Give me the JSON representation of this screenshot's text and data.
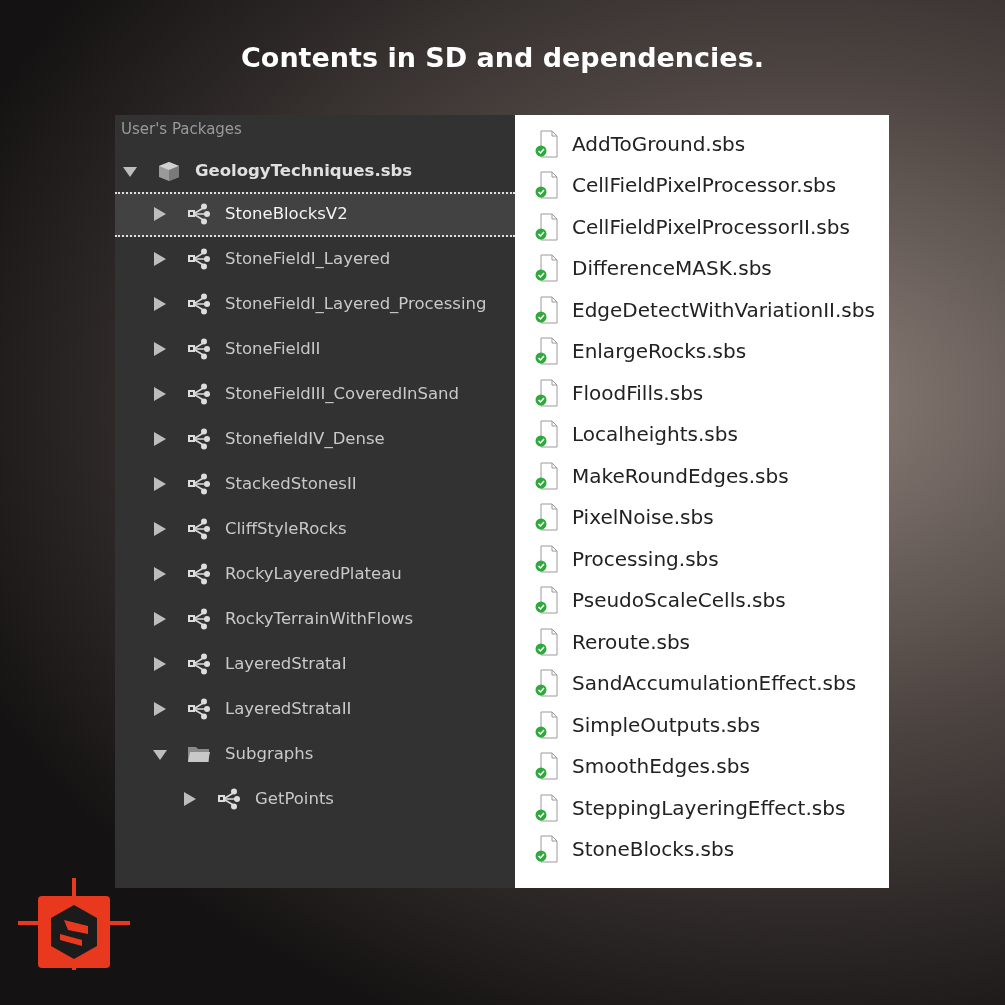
{
  "headline": "Contents in SD and dependencies.",
  "explorer": {
    "header": "User's Packages",
    "tree": [
      {
        "label": "GeologyTechniques.sbs",
        "kind": "package",
        "expanded": true,
        "selected": false,
        "children": [
          {
            "label": "StoneBlocksV2",
            "kind": "graph",
            "expanded": false,
            "selected": true
          },
          {
            "label": "StoneFieldI_Layered",
            "kind": "graph",
            "expanded": false,
            "selected": false
          },
          {
            "label": "StoneFieldI_Layered_Processing",
            "kind": "graph",
            "expanded": false,
            "selected": false
          },
          {
            "label": "StoneFieldII",
            "kind": "graph",
            "expanded": false,
            "selected": false
          },
          {
            "label": "StoneFieldIII_CoveredInSand",
            "kind": "graph",
            "expanded": false,
            "selected": false
          },
          {
            "label": "StonefieldIV_Dense",
            "kind": "graph",
            "expanded": false,
            "selected": false
          },
          {
            "label": "StackedStonesII",
            "kind": "graph",
            "expanded": false,
            "selected": false
          },
          {
            "label": "CliffStyleRocks",
            "kind": "graph",
            "expanded": false,
            "selected": false
          },
          {
            "label": "RockyLayeredPlateau",
            "kind": "graph",
            "expanded": false,
            "selected": false
          },
          {
            "label": "RockyTerrainWithFlows",
            "kind": "graph",
            "expanded": false,
            "selected": false
          },
          {
            "label": "LayeredStrataI",
            "kind": "graph",
            "expanded": false,
            "selected": false
          },
          {
            "label": "LayeredStrataII",
            "kind": "graph",
            "expanded": false,
            "selected": false
          },
          {
            "label": "Subgraphs",
            "kind": "folder",
            "expanded": true,
            "selected": false,
            "children": [
              {
                "label": "GetPoints",
                "kind": "graph",
                "expanded": false,
                "selected": false
              }
            ]
          }
        ]
      }
    ]
  },
  "files": [
    "AddToGround.sbs",
    "CellFieldPixelProcessor.sbs",
    "CellFieldPixelProcessorII.sbs",
    "DifferenceMASK.sbs",
    "EdgeDetectWithVariationII.sbs",
    "EnlargeRocks.sbs",
    "FloodFills.sbs",
    "Localheights.sbs",
    "MakeRoundEdges.sbs",
    "PixelNoise.sbs",
    "Processing.sbs",
    "PseudoScaleCells.sbs",
    "Reroute.sbs",
    "SandAccumulationEffect.sbs",
    "SimpleOutputs.sbs",
    "SmoothEdges.sbs",
    "SteppingLayeringEffect.sbs",
    "StoneBlocks.sbs"
  ]
}
